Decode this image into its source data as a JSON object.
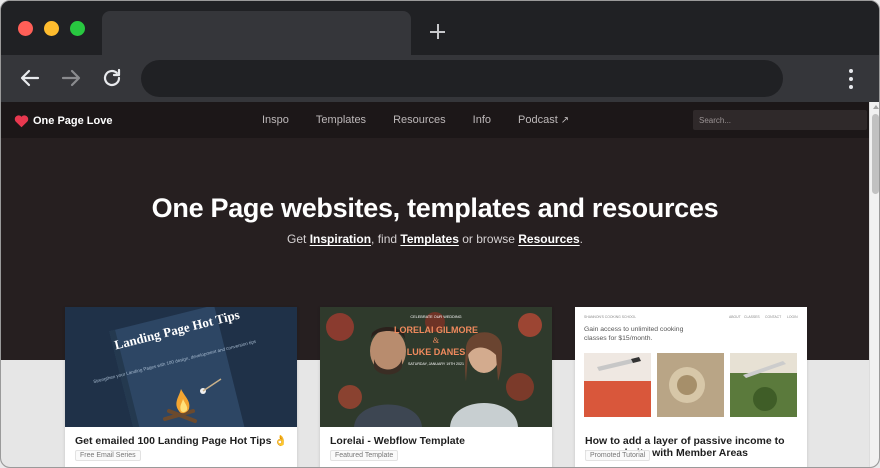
{
  "browser": {
    "new_tab_symbol": "+",
    "icons": [
      "back-arrow-icon",
      "forward-arrow-icon",
      "reload-icon",
      "kebab-menu-icon"
    ],
    "traffic_lights": [
      "#ff5f57",
      "#febc2e",
      "#28c840"
    ]
  },
  "site": {
    "logo_text": "One Page Love",
    "brand_color": "#e8384f",
    "nav": [
      {
        "label": "Inspo"
      },
      {
        "label": "Templates"
      },
      {
        "label": "Resources"
      },
      {
        "label": "Info"
      },
      {
        "label": "Podcast",
        "icon": "↗"
      }
    ],
    "search_placeholder": "Search..."
  },
  "hero": {
    "title": "One Page websites, templates and resources",
    "sub_prefix": "Get",
    "sub_link1": "Inspiration",
    "sub_mid1": ", find",
    "sub_link2": "Templates",
    "sub_mid2": "or browse",
    "sub_link3": "Resources",
    "sub_suffix": "."
  },
  "cards": [
    {
      "title": "Get emailed 100 Landing Page Hot Tips 👌",
      "tag": "Free Email Series",
      "thumb": {
        "book_title": "Landing Page Hot Tips",
        "book_sub": "Strengthen your Landing Pages with 100 design, development and conversion tips"
      }
    },
    {
      "title": "Lorelai - Webflow Template",
      "tag": "Featured Template",
      "thumb": {
        "top_text": "CELEBRATE OUR WEDDING",
        "name1": "LORELAI GILMORE",
        "amp": "&",
        "name2": "LUKE DANES",
        "date": "SATURDAY, JANUARY 19TH 2021"
      }
    },
    {
      "title": "How to add a layer of passive income to your website with Member Areas",
      "tag": "Promoted Tutorial",
      "thumb": {
        "brand": "SHANNON'S COOKING SCHOOL",
        "menu": [
          "ABOUT",
          "CLASSES",
          "CONTACT",
          "LOGIN"
        ],
        "headline": "Gain access to unlimited cooking classes for $15/month."
      }
    }
  ]
}
